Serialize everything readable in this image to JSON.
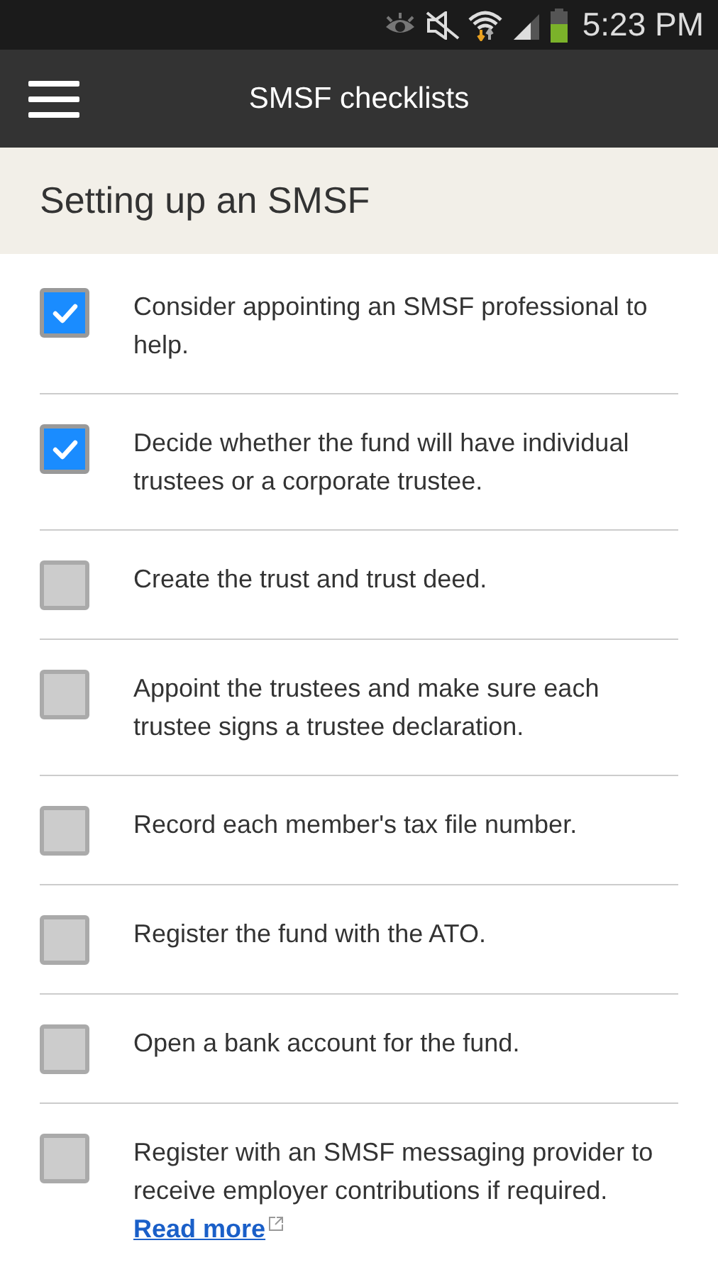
{
  "status_bar": {
    "time": "5:23 PM"
  },
  "app_bar": {
    "title": "SMSF checklists"
  },
  "section": {
    "title": "Setting up an SMSF"
  },
  "items": [
    {
      "text": "Consider appointing an SMSF professional to help.",
      "checked": true
    },
    {
      "text": "Decide whether the fund will have individual trustees or a corporate trustee.",
      "checked": true
    },
    {
      "text": "Create the trust and trust deed.",
      "checked": false
    },
    {
      "text": "Appoint the trustees and make sure each trustee signs a trustee declaration.",
      "checked": false
    },
    {
      "text": "Record each member's tax file number.",
      "checked": false
    },
    {
      "text": "Register the fund with the ATO.",
      "checked": false
    },
    {
      "text": "Open a bank account for the fund.",
      "checked": false
    },
    {
      "text": "Register with an SMSF messaging provider to receive employer contributions if required.",
      "link": "Read more",
      "checked": false
    }
  ]
}
